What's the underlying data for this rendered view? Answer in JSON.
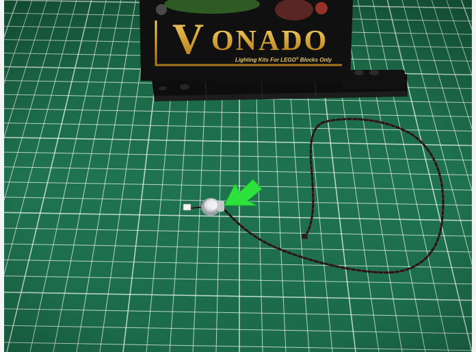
{
  "photo": {
    "brand_initial": "V",
    "brand_rest": "ONADO",
    "tagline": "Lighting Kits For LEGO",
    "tagline_mark": "®",
    "tagline_end": " Blocks Only",
    "colors": {
      "mat": "#1f6f4c",
      "mat_dark": "#0f4a32",
      "grid_line": "#dfeee6",
      "box": "#121212",
      "gold": "#d8a533",
      "arrow": "#27e23a",
      "wire_red": "#7a1e1e",
      "wire_black": "#1a1a1a",
      "led_housing": "#cfd3d6"
    }
  }
}
